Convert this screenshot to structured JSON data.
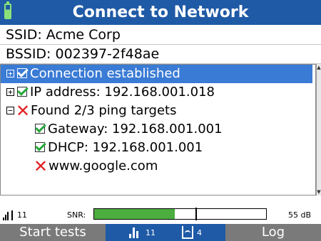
{
  "title": "Connect to Network",
  "ssid_line": "SSID: Acme Corp",
  "bssid_line": "BSSID: 002397-2f48ae",
  "tree": [
    {
      "label": "Connection established",
      "expander": "+",
      "status": "ok",
      "selected": true
    },
    {
      "label": "IP address: 192.168.001.018",
      "expander": "+",
      "status": "ok"
    },
    {
      "label": "Found 2/3 ping targets",
      "expander": "−",
      "status": "fail"
    },
    {
      "label": "Gateway: 192.168.001.001",
      "status": "ok"
    },
    {
      "label": "DHCP: 192.168.001.001",
      "status": "ok"
    },
    {
      "label": "www.google.com",
      "status": "fail"
    }
  ],
  "status": {
    "signal_value": "11",
    "snr_label": "SNR:",
    "snr_value": "55 dB",
    "snr_fill_fraction": 0.47,
    "snr_marker_fraction": 0.59
  },
  "softkeys": {
    "start_label": "Start tests",
    "signal_count": "11",
    "ap_count": "4",
    "log_label": "Log"
  },
  "colors": {
    "title_bar": "#1f5aa6",
    "selection": "#3a7bd5",
    "ok": "#26a83a",
    "fail": "#e02020",
    "snr_fill": "#4cae3f",
    "softkey_bar": "#7a7a7a"
  },
  "icons": {
    "battery": "battery-icon",
    "ok": "checkbox-check-icon",
    "fail": "red-x-icon",
    "signal": "signal-bars-icon",
    "access_point": "access-point-icon"
  }
}
